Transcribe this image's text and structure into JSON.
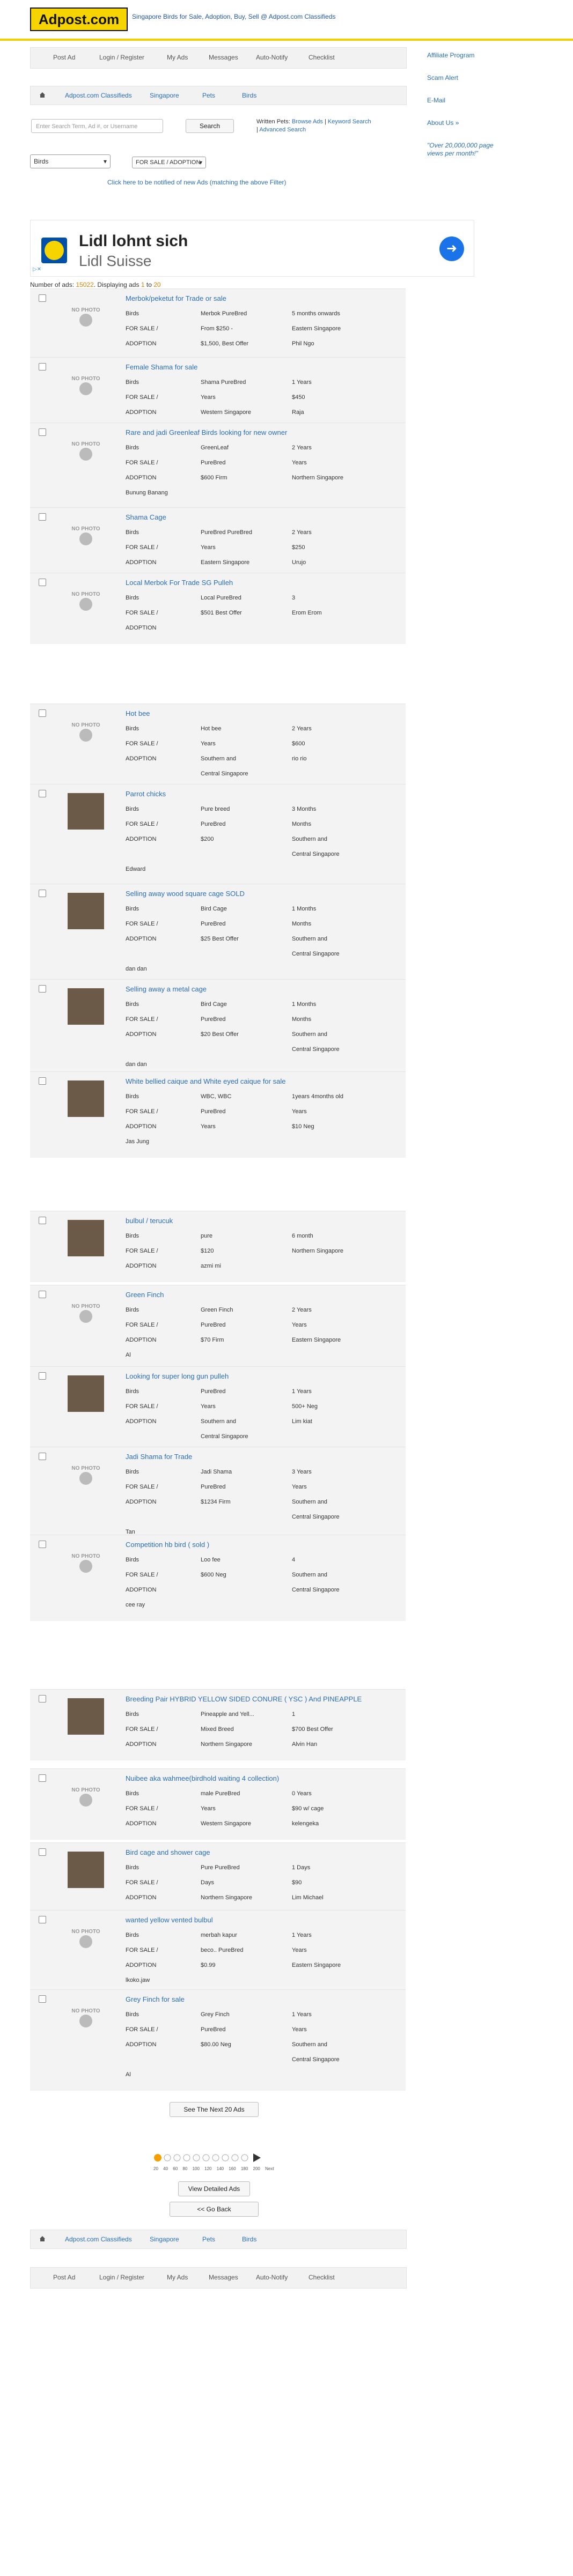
{
  "header": {
    "logo": "Adpost.com",
    "tagline": "Singapore Birds for Sale, Adoption, Buy, Sell @ Adpost.com Classifieds"
  },
  "nav": [
    "Post Ad",
    "Login / Register",
    "My Ads",
    "Messages",
    "Auto-Notify",
    "Checklist"
  ],
  "breadcrumb": [
    "Adpost.com Classifieds",
    "Singapore",
    "Pets",
    "Birds"
  ],
  "search": {
    "placeholder": "Enter Search Term, Ad #, or Username",
    "button": "Search",
    "written_label": "Written Pets:",
    "links": [
      "Browse Ads",
      "Keyword Search",
      "Advanced Search"
    ]
  },
  "filters": {
    "category": "Birds",
    "type": "FOR SALE / ADOPTION"
  },
  "notify_link": "Click here to be notified of new Ads (matching the above Filter)",
  "sidebar": {
    "links": [
      "Affiliate Program",
      "Scam Alert",
      "E-Mail",
      "About Us »"
    ],
    "quote": "\"Over 20,000,000 page views per month!\""
  },
  "ad": {
    "headline": "Lidl lohnt sich",
    "subline": "Lidl Suisse"
  },
  "results": {
    "prefix": "Number of ads:",
    "total": "15022",
    "mid": ". Displaying ads",
    "from": "1",
    "to_word": "to",
    "to": "20"
  },
  "listings": [
    {
      "title": "Merbok/peketut for Trade or sale",
      "photo": false,
      "rows": [
        [
          "Birds",
          "Merbok PureBred",
          "5 months onwards"
        ],
        [
          "FOR SALE /",
          "From $250 -",
          "Eastern Singapore"
        ],
        [
          "ADOPTION",
          "$1,500, Best Offer",
          "Phil Ngo"
        ]
      ],
      "seller": ""
    },
    {
      "title": "Female Shama for sale",
      "photo": false,
      "rows": [
        [
          "Birds",
          "Shama PureBred",
          "1 Years"
        ],
        [
          "FOR SALE /",
          "Years",
          "$450"
        ],
        [
          "ADOPTION",
          "Western Singapore",
          "Raja"
        ]
      ],
      "seller": ""
    },
    {
      "title": "Rare and jadi Greenleaf Birds looking for new owner",
      "photo": false,
      "rows": [
        [
          "Birds",
          "GreenLeaf",
          "2 Years"
        ],
        [
          "FOR SALE /",
          "PureBred",
          "Years"
        ],
        [
          "ADOPTION",
          "$600 Firm",
          "Northern Singapore"
        ]
      ],
      "seller": "Bunung Banang"
    },
    {
      "title": "Shama Cage",
      "photo": false,
      "rows": [
        [
          "Birds",
          "PureBred PureBred",
          "2 Years"
        ],
        [
          "FOR SALE /",
          "Years",
          "$250"
        ],
        [
          "ADOPTION",
          "Eastern Singapore",
          "Urujo"
        ]
      ],
      "seller": ""
    },
    {
      "title": "Local Merbok For Trade SG Pulleh",
      "photo": false,
      "rows": [
        [
          "Birds",
          "Local PureBred",
          "3"
        ],
        [
          "FOR SALE /",
          "$501 Best Offer",
          "Erom Erom"
        ],
        [
          "ADOPTION",
          "",
          ""
        ]
      ],
      "seller": ""
    },
    {
      "title": "Hot bee",
      "photo": false,
      "rows": [
        [
          "Birds",
          "Hot bee",
          "2 Years"
        ],
        [
          "FOR SALE /",
          "Years",
          "$600"
        ],
        [
          "ADOPTION",
          "Southern and",
          "rio rio"
        ],
        [
          "",
          "Central Singapore",
          ""
        ]
      ],
      "seller": ""
    },
    {
      "title": "Parrot chicks",
      "photo": true,
      "rows": [
        [
          "Birds",
          "Pure breed",
          "3 Months"
        ],
        [
          "FOR SALE /",
          "PureBred",
          "Months"
        ],
        [
          "ADOPTION",
          "$200",
          "Southern and"
        ],
        [
          "",
          "",
          "Central Singapore"
        ]
      ],
      "seller": "Edward"
    },
    {
      "title": "Selling away wood square cage SOLD",
      "photo": true,
      "rows": [
        [
          "Birds",
          "Bird Cage",
          "1 Months"
        ],
        [
          "FOR SALE /",
          "PureBred",
          "Months"
        ],
        [
          "ADOPTION",
          "$25 Best Offer",
          "Southern and"
        ],
        [
          "",
          "",
          "Central Singapore"
        ]
      ],
      "seller": "dan dan"
    },
    {
      "title": "Selling away a metal cage",
      "photo": true,
      "rows": [
        [
          "Birds",
          "Bird Cage",
          "1 Months"
        ],
        [
          "FOR SALE /",
          "PureBred",
          "Months"
        ],
        [
          "ADOPTION",
          "$20 Best Offer",
          "Southern and"
        ],
        [
          "",
          "",
          "Central Singapore"
        ]
      ],
      "seller": "dan dan"
    },
    {
      "title": "White bellied caique and White eyed caique for sale",
      "photo": true,
      "rows": [
        [
          "Birds",
          "WBC, WBC",
          "1years 4months old"
        ],
        [
          "FOR SALE /",
          "PureBred",
          "Years"
        ],
        [
          "ADOPTION",
          "Years",
          "$10 Neg"
        ]
      ],
      "seller": "Jas Jung"
    },
    {
      "title": "bulbul / terucuk",
      "photo": true,
      "rows": [
        [
          "Birds",
          "pure",
          "6 month"
        ],
        [
          "FOR SALE /",
          "$120",
          "Northern Singapore"
        ],
        [
          "ADOPTION",
          "azmi mi",
          ""
        ]
      ],
      "seller": ""
    },
    {
      "title": "Green Finch",
      "photo": false,
      "rows": [
        [
          "Birds",
          "Green Finch",
          "2 Years"
        ],
        [
          "FOR SALE /",
          "PureBred",
          "Years"
        ],
        [
          "ADOPTION",
          "$70 Firm",
          "Eastern Singapore"
        ]
      ],
      "seller": "Al"
    },
    {
      "title": "Looking for super long gun pulleh",
      "photo": true,
      "rows": [
        [
          "Birds",
          "PureBred",
          "1 Years"
        ],
        [
          "FOR SALE /",
          "Years",
          "500+ Neg"
        ],
        [
          "ADOPTION",
          "Southern and",
          "Lim kiat"
        ],
        [
          "",
          "Central Singapore",
          ""
        ]
      ],
      "seller": ""
    },
    {
      "title": "Jadi Shama for Trade",
      "photo": false,
      "rows": [
        [
          "Birds",
          "Jadi Shama",
          "3 Years"
        ],
        [
          "FOR SALE /",
          "PureBred",
          "Years"
        ],
        [
          "ADOPTION",
          "$1234 Firm",
          "Southern and"
        ],
        [
          "",
          "",
          "Central Singapore"
        ]
      ],
      "seller": "Tan"
    },
    {
      "title": "Competition hb bird ( sold )",
      "photo": false,
      "rows": [
        [
          "Birds",
          "Loo fee",
          "4"
        ],
        [
          "FOR SALE /",
          "$600 Neg",
          "Southern and"
        ],
        [
          "ADOPTION",
          "",
          "Central Singapore"
        ]
      ],
      "seller": "cee ray"
    },
    {
      "title": "Breeding Pair HYBRID YELLOW SIDED CONURE ( YSC ) And PINEAPPLE",
      "photo": true,
      "rows": [
        [
          "Birds",
          "Pineapple and Yell...",
          "1"
        ],
        [
          "FOR SALE /",
          "Mixed Breed",
          "$700 Best Offer"
        ],
        [
          "ADOPTION",
          "Northern Singapore",
          "Alvin Han"
        ]
      ],
      "seller": ""
    },
    {
      "title": "Nuibee aka wahmee(birdhold waiting 4 collection)",
      "photo": false,
      "rows": [
        [
          "Birds",
          "male PureBred",
          "0 Years"
        ],
        [
          "FOR SALE /",
          "Years",
          "$90 w/ cage"
        ],
        [
          "ADOPTION",
          "Western Singapore",
          "kelengeka"
        ]
      ],
      "seller": ""
    },
    {
      "title": "Bird cage and shower cage",
      "photo": true,
      "rows": [
        [
          "Birds",
          "Pure PureBred",
          "1 Days"
        ],
        [
          "FOR SALE /",
          "Days",
          "$90"
        ],
        [
          "ADOPTION",
          "Northern Singapore",
          "Lim Michael"
        ]
      ],
      "seller": ""
    },
    {
      "title": "wanted yellow vented bulbul",
      "photo": false,
      "rows": [
        [
          "Birds",
          "merbah kapur",
          "1 Years"
        ],
        [
          "FOR SALE /",
          "beco.. PureBred",
          "Years"
        ],
        [
          "ADOPTION",
          "$0.99",
          "Eastern Singapore"
        ]
      ],
      "seller": "lkoko.jaw"
    },
    {
      "title": "Grey Finch for sale",
      "photo": false,
      "rows": [
        [
          "Birds",
          "Grey Finch",
          "1 Years"
        ],
        [
          "FOR SALE /",
          "PureBred",
          "Years"
        ],
        [
          "ADOPTION",
          "$80.00 Neg",
          "Southern and"
        ],
        [
          "",
          "",
          "Central Singapore"
        ]
      ],
      "seller": "Al"
    }
  ],
  "no_photo_text": "NO PHOTO",
  "buttons": {
    "next": "See The Next 20 Ads",
    "detailed": "View Detailed Ads",
    "back": "<< Go Back"
  },
  "pager_labels": [
    "20",
    "40",
    "60",
    "80",
    "100",
    "120",
    "140",
    "160",
    "180",
    "200",
    "Next"
  ],
  "colors": {
    "accent": "#f5d400",
    "link": "#2a6ebb",
    "row_bg": "#f3f3f3"
  }
}
